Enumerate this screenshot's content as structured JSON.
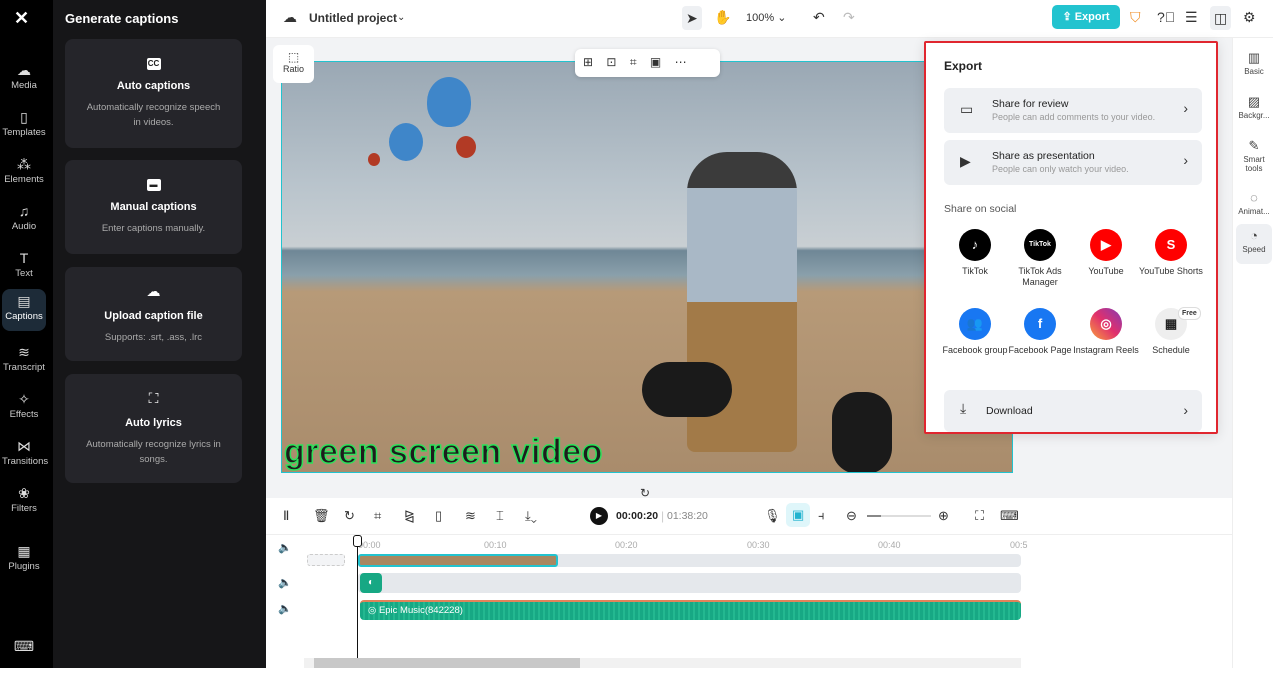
{
  "rail": {
    "items": [
      {
        "label": "Media",
        "icon": "cloud-upload-icon"
      },
      {
        "label": "Templates",
        "icon": "templates-icon"
      },
      {
        "label": "Elements",
        "icon": "elements-icon"
      },
      {
        "label": "Audio",
        "icon": "music-icon"
      },
      {
        "label": "Text",
        "icon": "text-icon"
      },
      {
        "label": "Captions",
        "icon": "captions-icon"
      },
      {
        "label": "Transcript",
        "icon": "transcript-icon"
      },
      {
        "label": "Effects",
        "icon": "effects-icon"
      },
      {
        "label": "Transitions",
        "icon": "transitions-icon"
      },
      {
        "label": "Filters",
        "icon": "filters-icon"
      },
      {
        "label": "Plugins",
        "icon": "plugins-icon"
      }
    ]
  },
  "panel": {
    "title": "Generate captions",
    "cards": [
      {
        "title": "Auto captions",
        "desc": "Automatically recognize speech in videos.",
        "icon": "CC"
      },
      {
        "title": "Manual captions",
        "desc": "Enter captions manually."
      },
      {
        "title": "Upload caption file",
        "desc": "Supports: .srt, .ass, .lrc"
      },
      {
        "title": "Auto lyrics",
        "desc": "Automatically recognize lyrics in songs."
      }
    ]
  },
  "topbar": {
    "project": "Untitled project",
    "zoom": "100%",
    "export": "Export"
  },
  "stage": {
    "ratio": "Ratio",
    "caption": "green screen video"
  },
  "export": {
    "title": "Export",
    "review_title": "Share for review",
    "review_sub": "People can add comments to your video.",
    "present_title": "Share as presentation",
    "present_sub": "People can only watch your video.",
    "social_label": "Share on social",
    "social": [
      {
        "label": "TikTok",
        "color": "#000000"
      },
      {
        "label": "TikTok Ads Manager",
        "color": "#000000"
      },
      {
        "label": "YouTube",
        "color": "#ff0000"
      },
      {
        "label": "YouTube Shorts",
        "color": "#ff0000"
      },
      {
        "label": "Facebook group",
        "color": "#1877f2"
      },
      {
        "label": "Facebook Page",
        "color": "#1877f2"
      },
      {
        "label": "Instagram Reels",
        "color": "#e1306c"
      },
      {
        "label": "Schedule",
        "color": "#eeeeee"
      }
    ],
    "free_badge": "Free",
    "download": "Download"
  },
  "rrail": {
    "items": [
      "Basic",
      "Backgr...",
      "Smart tools",
      "Animat...",
      "Speed"
    ]
  },
  "timeline": {
    "current": "00:00:20",
    "total": "01:38:20",
    "ticks": [
      "00:00",
      "00:10",
      "00:20",
      "00:30",
      "00:40",
      "00:5"
    ],
    "music": "Epic Music(842228)"
  }
}
